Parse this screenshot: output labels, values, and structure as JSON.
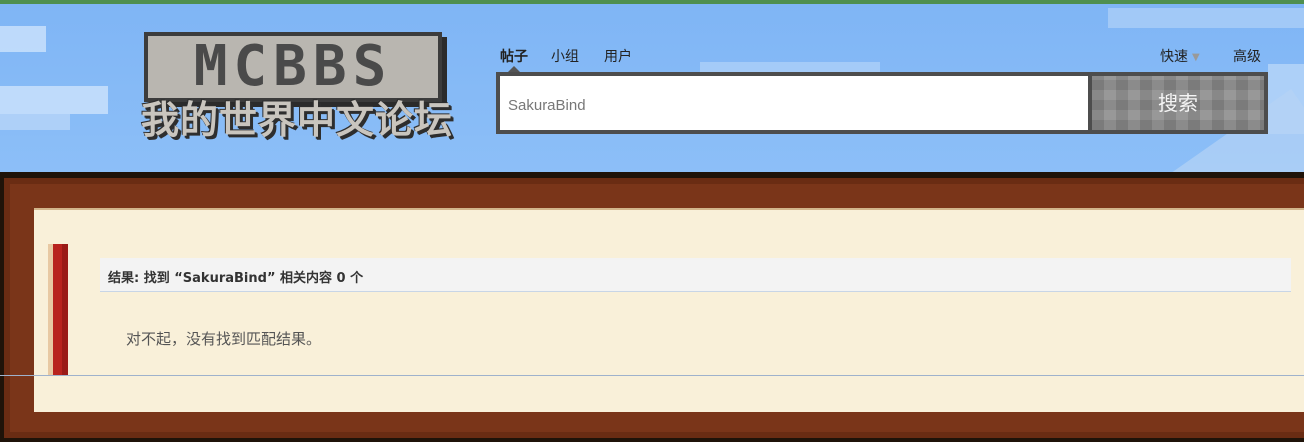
{
  "logo": {
    "mark": "MCBBS",
    "subtitle": "我的世界中文论坛"
  },
  "search": {
    "tabs": [
      "帖子",
      "小组",
      "用户"
    ],
    "active_tab": "帖子",
    "query": "SakuraBind",
    "button_label": "搜索"
  },
  "nav": {
    "quick": "快速",
    "advanced": "高级"
  },
  "results": {
    "summary": "结果: 找到 “SakuraBind” 相关内容 0 个",
    "empty_message": "对不起，没有找到匹配结果。"
  }
}
